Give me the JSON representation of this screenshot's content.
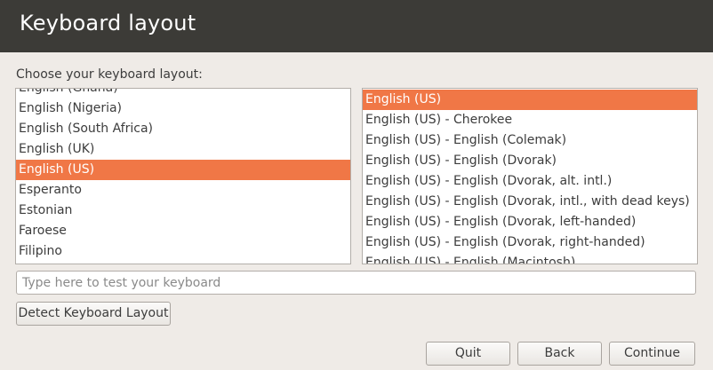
{
  "header": {
    "title": "Keyboard layout"
  },
  "prompt": "Choose your keyboard layout:",
  "layouts": [
    "English (Ghana)",
    "English (Nigeria)",
    "English (South Africa)",
    "English (UK)",
    "English (US)",
    "Esperanto",
    "Estonian",
    "Faroese",
    "Filipino"
  ],
  "selected_layout": "English (US)",
  "variants": [
    "English (US)",
    "English (US) - Cherokee",
    "English (US) - English (Colemak)",
    "English (US) - English (Dvorak)",
    "English (US) - English (Dvorak, alt. intl.)",
    "English (US) - English (Dvorak, intl., with dead keys)",
    "English (US) - English (Dvorak, left-handed)",
    "English (US) - English (Dvorak, right-handed)",
    "English (US) - English (Macintosh)"
  ],
  "selected_variant": "English (US)",
  "test_field": {
    "placeholder": "Type here to test your keyboard",
    "value": ""
  },
  "buttons": {
    "detect": "Detect Keyboard Layout",
    "quit": "Quit",
    "back": "Back",
    "continue": "Continue"
  },
  "colors": {
    "header_bg": "#3c3b37",
    "selection": "#f07746",
    "window_bg": "#efebe7"
  }
}
